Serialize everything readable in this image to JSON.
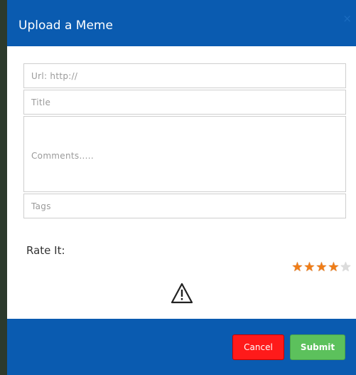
{
  "dialog": {
    "title": "Upload a Meme",
    "close_label": "×"
  },
  "form": {
    "url_placeholder": "Url: http://",
    "title_placeholder": "Title",
    "comments_placeholder": "Comments.....",
    "tags_placeholder": "Tags"
  },
  "rating": {
    "label": "Rate It:",
    "value": 4,
    "max": 5,
    "filled_color": "#f07d17",
    "empty_color": "#dcdcdc",
    "star_glyph": "★"
  },
  "icons": {
    "warning": "warning-triangle-icon"
  },
  "footer": {
    "cancel_label": "Cancel",
    "submit_label": "Submit"
  },
  "colors": {
    "header_bg": "#0a5bb0",
    "footer_bg": "#0a5bb0",
    "cancel_bg": "#ff1a1a",
    "submit_bg": "#5cc15c"
  }
}
